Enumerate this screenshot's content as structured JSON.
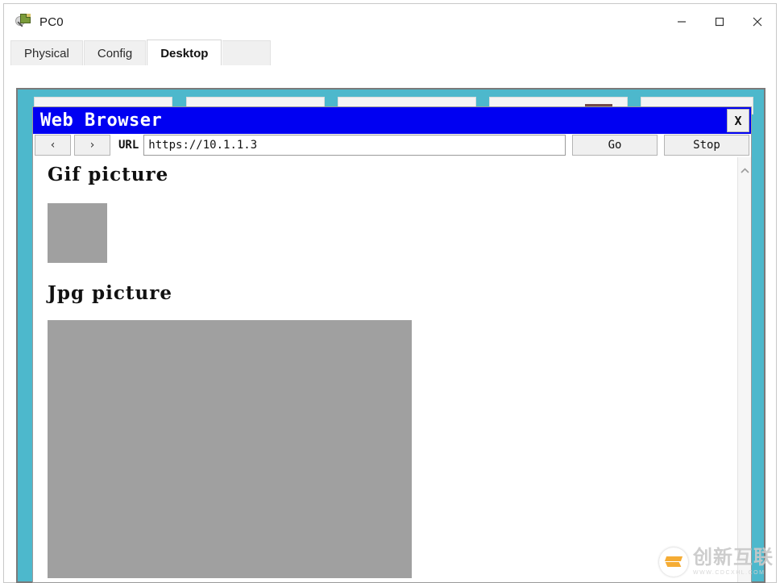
{
  "window": {
    "title": "PC0",
    "icon": "packet-tracer-device-icon",
    "controls": {
      "minimize": "minimize-icon",
      "maximize": "maximize-icon",
      "close": "close-icon"
    }
  },
  "tabs": [
    {
      "label": "Physical",
      "active": false
    },
    {
      "label": "Config",
      "active": false
    },
    {
      "label": "Desktop",
      "active": true
    }
  ],
  "desktop": {
    "background_color": "#4db8cc",
    "tiles": [
      {
        "name": "desktop-tile-1"
      },
      {
        "name": "desktop-tile-2"
      },
      {
        "name": "desktop-tile-3"
      },
      {
        "name": "desktop-tile-4"
      },
      {
        "name": "desktop-tile-5"
      }
    ]
  },
  "browser": {
    "title": "Web Browser",
    "title_bar_color": "#0000f2",
    "close_label": "X",
    "toolbar": {
      "back_label": "‹",
      "forward_label": "›",
      "url_label": "URL",
      "url_value": "https://10.1.1.3",
      "url_placeholder": "https://",
      "go_label": "Go",
      "stop_label": "Stop"
    },
    "page": {
      "sections": [
        {
          "heading": "Gif picture",
          "image": "gif-image-placeholder"
        },
        {
          "heading": "Jpg picture",
          "image": "jpg-image-placeholder"
        }
      ]
    },
    "scrollbar": {
      "up_arrow": "chevron-up-icon"
    }
  },
  "watermark": {
    "text_cn": "创新互联",
    "text_sub": "WWW.CDCXHL.COM",
    "logo": "cdcxhl-logo-icon"
  }
}
